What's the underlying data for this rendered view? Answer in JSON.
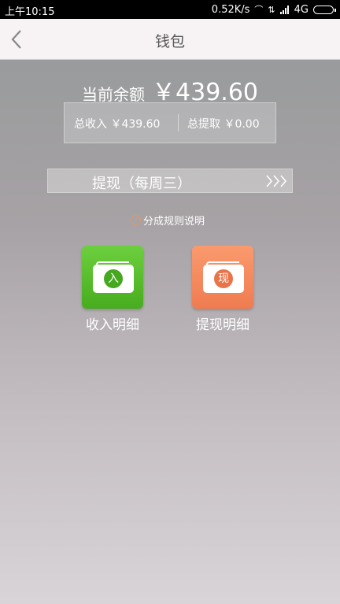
{
  "status_bar": {
    "time": "上午10:15",
    "net_speed": "0.52K/s",
    "network": "4G"
  },
  "header": {
    "title": "钱包"
  },
  "balance": {
    "label": "当前余额",
    "amount": "￥439.60"
  },
  "summary": {
    "total_income": "总收入 ￥439.60",
    "total_withdrawn": "总提取 ￥0.00"
  },
  "withdraw": {
    "label": "提现（每周三）"
  },
  "rules_link": {
    "label": "分成规则说明"
  },
  "actions": [
    {
      "label": "收入明细",
      "icon_char": "入",
      "icon": "income-wallet-icon",
      "color": "#55b929"
    },
    {
      "label": "提现明细",
      "icon_char": "现",
      "icon": "withdraw-wallet-icon",
      "color": "#f58a5e"
    }
  ]
}
